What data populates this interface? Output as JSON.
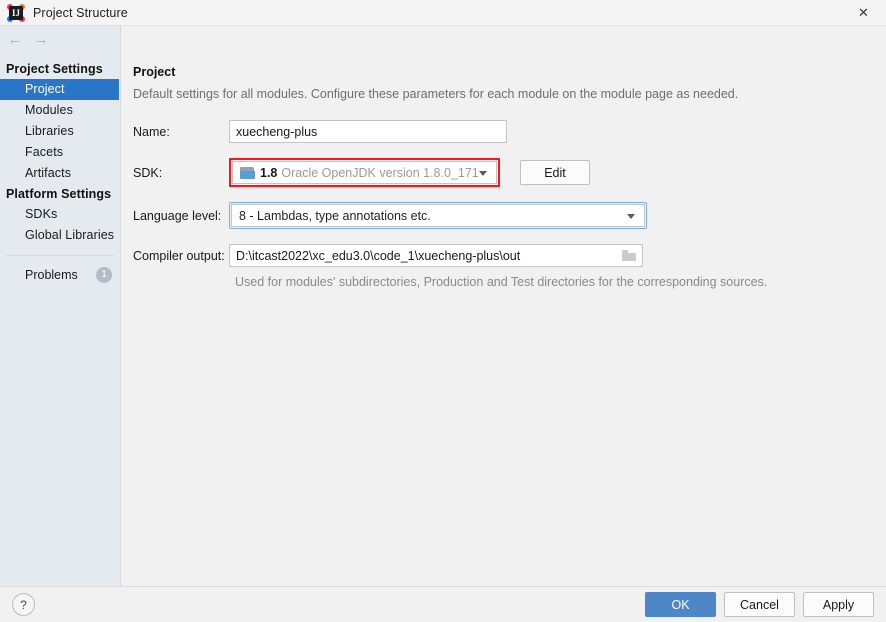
{
  "window": {
    "title": "Project Structure",
    "app_icon": "intellij-idea-icon",
    "close_label": "✕"
  },
  "nav": {
    "back": "←",
    "forward": "→"
  },
  "sidebar": {
    "groups": [
      {
        "title": "Project Settings",
        "items": [
          {
            "label": "Project",
            "selected": true
          },
          {
            "label": "Modules",
            "selected": false
          },
          {
            "label": "Libraries",
            "selected": false
          },
          {
            "label": "Facets",
            "selected": false
          },
          {
            "label": "Artifacts",
            "selected": false
          }
        ]
      },
      {
        "title": "Platform Settings",
        "items": [
          {
            "label": "SDKs",
            "selected": false
          },
          {
            "label": "Global Libraries",
            "selected": false
          }
        ]
      }
    ],
    "problems": {
      "label": "Problems",
      "count": "1"
    }
  },
  "main": {
    "title": "Project",
    "description": "Default settings for all modules. Configure these parameters for each module on the module page as needed.",
    "name": {
      "label": "Name:",
      "value": "xuecheng-plus"
    },
    "sdk": {
      "label": "SDK:",
      "version": "1.8",
      "description": "Oracle OpenJDK version 1.8.0_171",
      "edit_label": "Edit",
      "highlight_color": "#f01c1c"
    },
    "language_level": {
      "label": "Language level:",
      "value": "8 - Lambdas, type annotations etc.",
      "focus_color": "#7aaede"
    },
    "compiler_output": {
      "label": "Compiler output:",
      "value": "D:\\itcast2022\\xc_edu3.0\\code_1\\xuecheng-plus\\out",
      "hint": "Used for modules' subdirectories, Production and Test directories for the corresponding sources."
    }
  },
  "footer": {
    "help": "?",
    "ok": "OK",
    "cancel": "Cancel",
    "apply": "Apply",
    "primary_color": "#4d87c7"
  }
}
